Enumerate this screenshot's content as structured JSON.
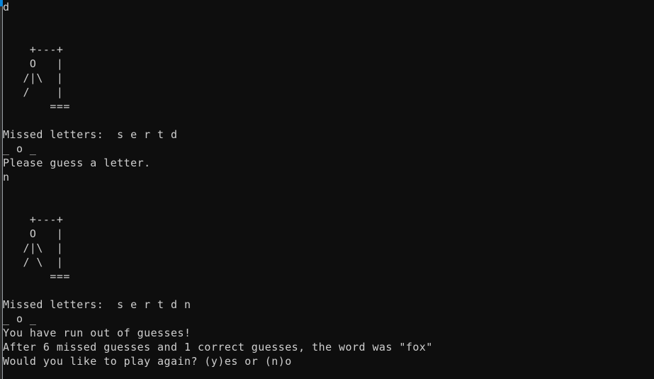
{
  "terminal": {
    "background_color": "#0e0e0e",
    "text_color": "#cfcfcf",
    "scrollbar": {
      "name": "vertical-scrollbar",
      "track_color": "#2a2a2a",
      "thumb_color": "#0a84d8",
      "edge_line_color": "#9aa0a6"
    }
  },
  "session": {
    "game": "Hangman",
    "lines": [
      "d",
      "",
      "",
      "    +---+",
      "    O   |",
      "   /|\\  |",
      "   /    |",
      "       ===",
      "",
      "Missed letters:  s e r t d",
      "_ o _",
      "Please guess a letter.",
      "n",
      "",
      "",
      "    +---+",
      "    O   |",
      "   /|\\  |",
      "   / \\  |",
      "       ===",
      "",
      "Missed letters:  s e r t d n",
      "_ o _",
      "You have run out of guesses!",
      "After 6 missed guesses and 1 correct guesses, the word was \"fox\"",
      "Would you like to play again? (y)es or (n)o"
    ],
    "echoed_input_first": "d",
    "echoed_input_second": "n",
    "hangman_art_first": [
      "    +---+",
      "    O   |",
      "   /|\\  |",
      "   /    |",
      "       ==="
    ],
    "hangman_art_second": [
      "    +---+",
      "    O   |",
      "   /|\\  |",
      "   / \\  |",
      "       ==="
    ],
    "missed_letters_first": "Missed letters:  s e r t d",
    "missed_letters_second": "Missed letters:  s e r t d n",
    "word_progress": "_ o _",
    "prompt_guess": "Please guess a letter.",
    "message_out_of_guesses": "You have run out of guesses!",
    "message_summary": "After 6 missed guesses and 1 correct guesses, the word was \"fox\"",
    "prompt_play_again": "Would you like to play again? (y)es or (n)o",
    "missed_count": "6",
    "correct_count": "1",
    "secret_word": "fox"
  }
}
